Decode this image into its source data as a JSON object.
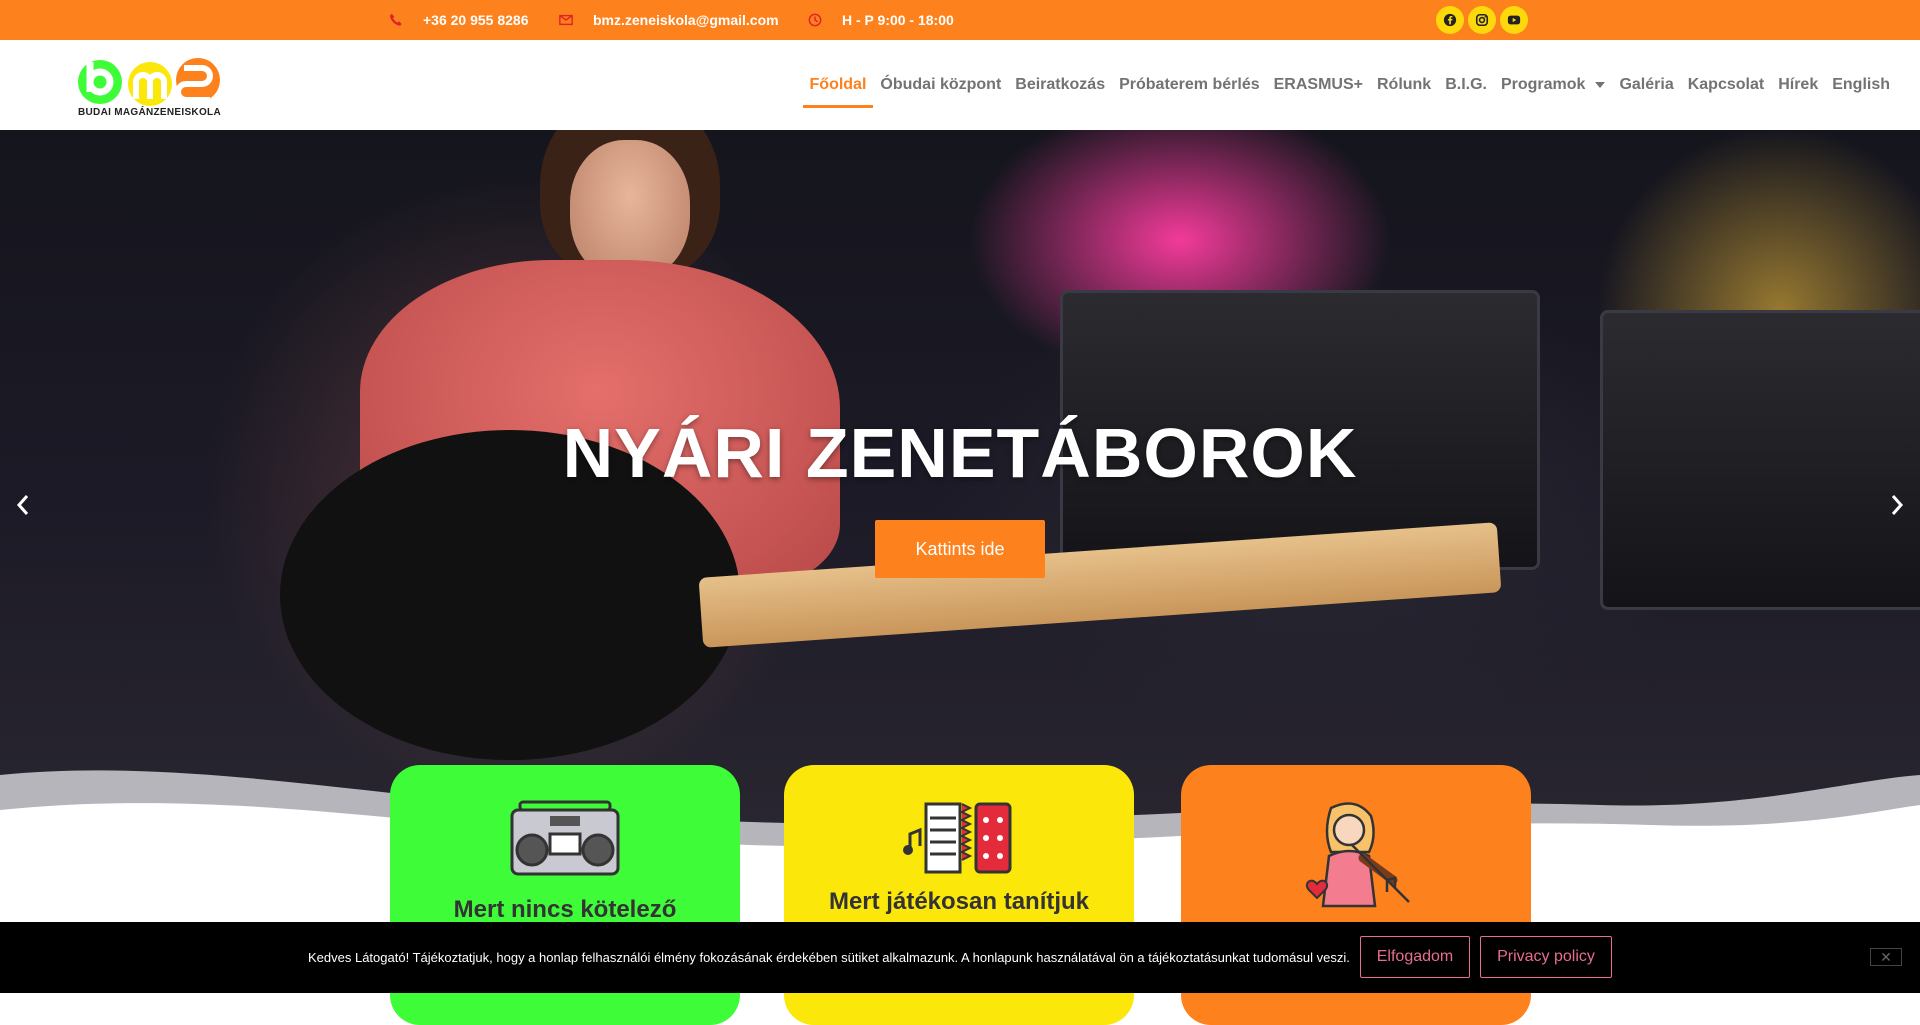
{
  "topbar": {
    "phone": "+36 20 955 8286",
    "email": "bmz.zeneiskola@gmail.com",
    "hours": "H - P 9:00 - 18:00",
    "social": [
      "facebook-icon",
      "instagram-icon",
      "youtube-icon"
    ]
  },
  "logo": {
    "text": "BUDAI MAGÁNZENEISKOLA"
  },
  "nav": {
    "items": [
      "Főoldal",
      "Óbudai központ",
      "Beiratkozás",
      "Próbaterem bérlés",
      "ERASMUS+",
      "Rólunk",
      "B.I.G.",
      "Programok",
      "Galéria",
      "Kapcsolat",
      "Hírek",
      "English"
    ],
    "active": "Főoldal"
  },
  "hero": {
    "title": "NYÁRI ZENETÁBOROK",
    "button": "Kattints ide"
  },
  "cards": [
    {
      "title": "Mert nincs kötelező",
      "color": "#3efc37",
      "icon": "boombox-icon"
    },
    {
      "title": "Mert játékosan tanítjuk",
      "color": "#fbe80a",
      "icon": "accordion-icon"
    },
    {
      "title": "",
      "color": "#fd811c",
      "icon": "violinist-icon"
    }
  ],
  "cookie": {
    "text": "Kedves Látogató! Tájékoztatjuk, hogy a honlap felhasználói élmény fokozásának érdekében sütiket alkalmazunk. A honlapunk használatával ön a tájékoztatásunkat tudomásul veszi.",
    "accept": "Elfogadom",
    "privacy": "Privacy policy",
    "close": "✕"
  },
  "colors": {
    "accent": "#fd811c",
    "yellow": "#fdd90c",
    "green": "#3efc37",
    "pink": "#e86d8f"
  }
}
